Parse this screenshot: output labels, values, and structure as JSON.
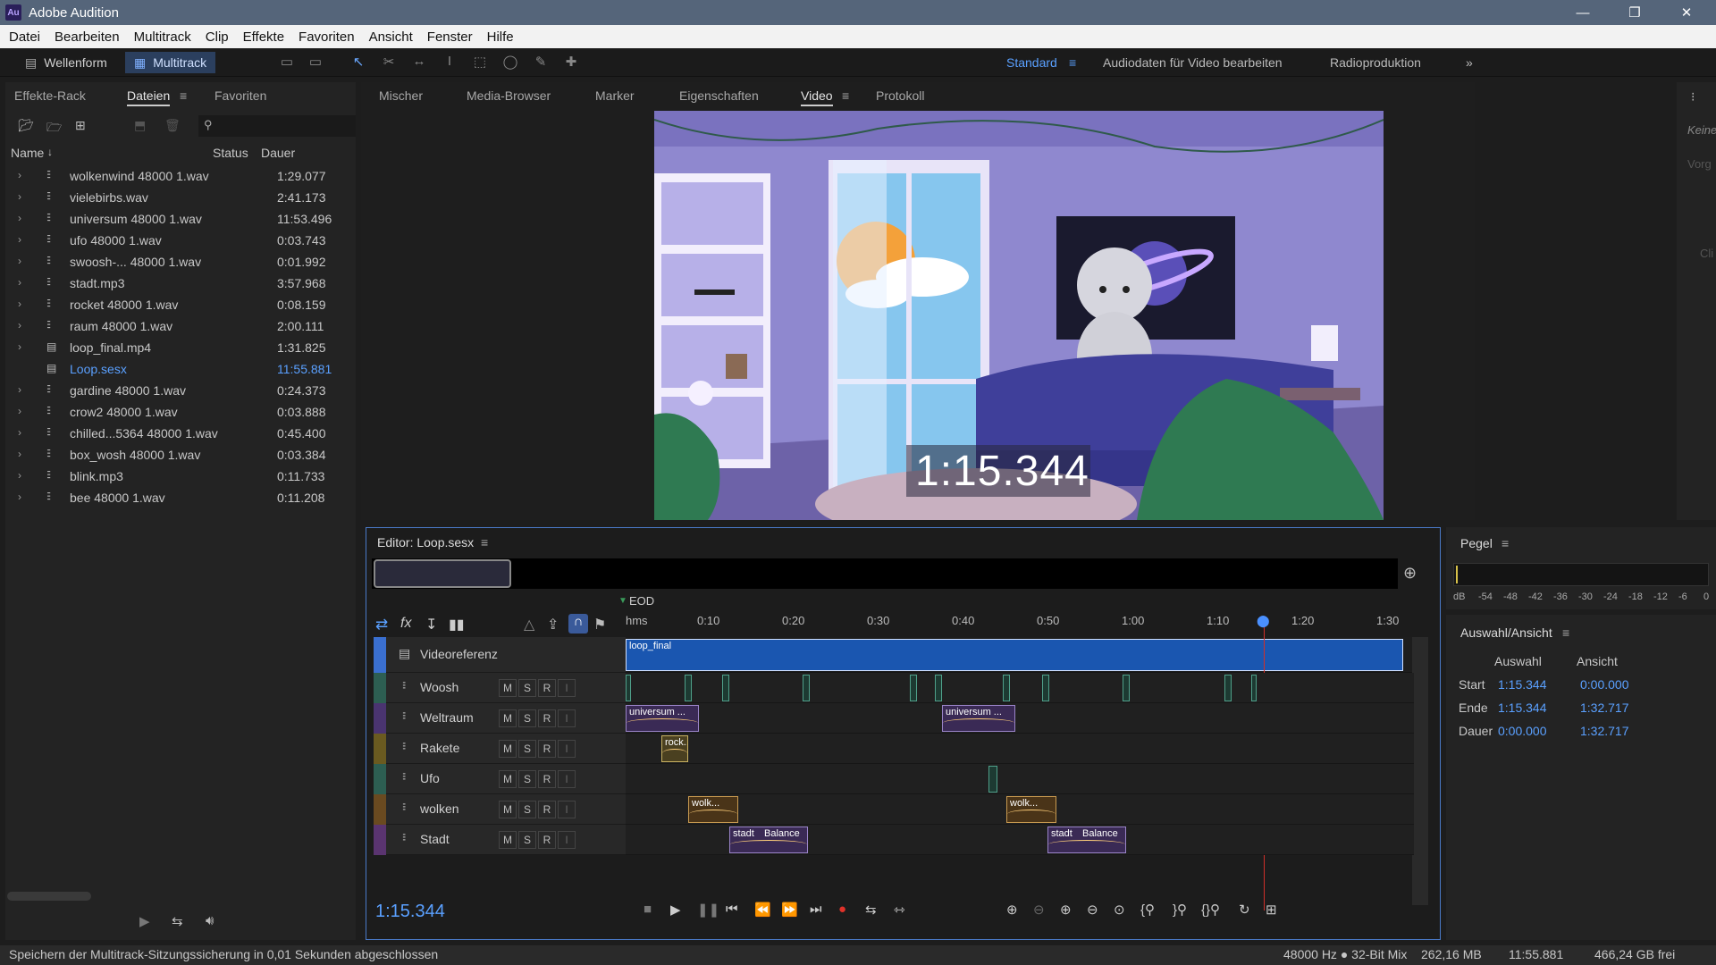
{
  "app": {
    "title": "Adobe Audition",
    "logo": "Au"
  },
  "menu": [
    "Datei",
    "Bearbeiten",
    "Multitrack",
    "Clip",
    "Effekte",
    "Favoriten",
    "Ansicht",
    "Fenster",
    "Hilfe"
  ],
  "toolbar": {
    "waveform": "Wellenform",
    "multitrack": "Multitrack",
    "workspaces": [
      "Standard",
      "Audiodaten für Video bearbeiten",
      "Radioproduktion"
    ]
  },
  "left_panel": {
    "tabs": [
      "Effekte-Rack",
      "Dateien",
      "Favoriten"
    ],
    "columns": {
      "name": "Name",
      "status": "Status",
      "duration": "Dauer"
    },
    "files": [
      {
        "name": "wolkenwind 48000 1.wav",
        "duration": "1:29.077"
      },
      {
        "name": "vielebirbs.wav",
        "duration": "2:41.173"
      },
      {
        "name": "universum 48000 1.wav",
        "duration": "11:53.496"
      },
      {
        "name": "ufo 48000 1.wav",
        "duration": "0:03.743"
      },
      {
        "name": "swoosh-... 48000 1.wav",
        "duration": "0:01.992"
      },
      {
        "name": "stadt.mp3",
        "duration": "3:57.968"
      },
      {
        "name": "rocket 48000 1.wav",
        "duration": "0:08.159"
      },
      {
        "name": "raum 48000 1.wav",
        "duration": "2:00.111"
      },
      {
        "name": "loop_final.mp4",
        "duration": "1:31.825"
      },
      {
        "name": "Loop.sesx",
        "duration": "11:55.881"
      },
      {
        "name": "gardine 48000 1.wav",
        "duration": "0:24.373"
      },
      {
        "name": "crow2 48000 1.wav",
        "duration": "0:03.888"
      },
      {
        "name": "chilled...5364 48000 1.wav",
        "duration": "0:45.400"
      },
      {
        "name": "box_wosh 48000 1.wav",
        "duration": "0:03.384"
      },
      {
        "name": "blink.mp3",
        "duration": "0:11.733"
      },
      {
        "name": "bee 48000 1.wav",
        "duration": "0:11.208"
      }
    ]
  },
  "top_tabs": [
    "Mischer",
    "Media-Browser",
    "Marker",
    "Eigenschaften",
    "Video",
    "Protokoll"
  ],
  "video": {
    "timecode": "1:15.344"
  },
  "right_strip": {
    "a": "Keine",
    "b": "Vorg",
    "c": "Cli"
  },
  "editor": {
    "title": "Editor: Loop.sesx",
    "eod": "EOD",
    "ruler_unit": "hms",
    "ruler": [
      "0:10",
      "0:20",
      "0:30",
      "0:40",
      "0:50",
      "1:00",
      "1:10",
      "1:20",
      "1:30"
    ],
    "current_time": "1:15.344",
    "video_track": {
      "name": "Videoreferenz",
      "clip": "loop_final"
    },
    "msr": {
      "m": "M",
      "s": "S",
      "r": "R"
    },
    "tracks": [
      {
        "name": "Woosh",
        "color": "#2d5e52"
      },
      {
        "name": "Weltraum",
        "color": "#4a3470"
      },
      {
        "name": "Rakete",
        "color": "#6a5a20"
      },
      {
        "name": "Ufo",
        "color": "#2d5e52"
      },
      {
        "name": "wolken",
        "color": "#6a4a20"
      },
      {
        "name": "Stadt",
        "color": "#5a3470"
      }
    ],
    "clip_labels": {
      "universum": "universum ...",
      "rock": "rock...",
      "wolk": "wolk...",
      "stadt": "stadt",
      "balance": "Balance"
    }
  },
  "meter": {
    "title": "Pegel",
    "scale": [
      "dB",
      "-54",
      "-48",
      "-42",
      "-36",
      "-30",
      "-24",
      "-18",
      "-12",
      "-6",
      "0"
    ]
  },
  "selection": {
    "title": "Auswahl/Ansicht",
    "col_sel": "Auswahl",
    "col_view": "Ansicht",
    "rows": [
      {
        "label": "Start",
        "sel": "1:15.344",
        "view": "0:00.000"
      },
      {
        "label": "Ende",
        "sel": "1:15.344",
        "view": "1:32.717"
      },
      {
        "label": "Dauer",
        "sel": "0:00.000",
        "view": "1:32.717"
      }
    ]
  },
  "status": {
    "message": "Speichern der Multitrack-Sitzungssicherung in 0,01 Sekunden abgeschlossen",
    "format": "48000 Hz ● 32-Bit Mix",
    "memory": "262,16 MB",
    "duration": "11:55.881",
    "free": "466,24 GB frei"
  }
}
